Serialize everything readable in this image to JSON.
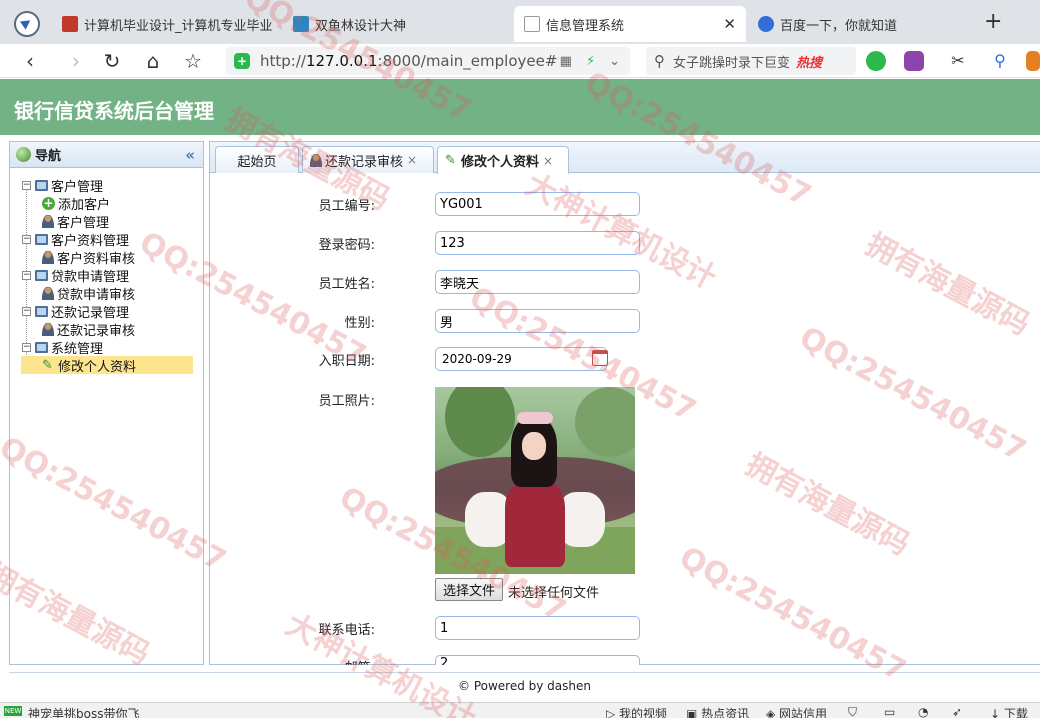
{
  "browser": {
    "tabs": [
      {
        "title": "计算机毕业设计_计算机专业毕业",
        "favicon_color": "#c0392b"
      },
      {
        "title": "双鱼林设计大神",
        "favicon_color": "#2e86c1"
      },
      {
        "title": "信息管理系统",
        "favicon_color": "#bbbbbb"
      },
      {
        "title": "百度一下，你就知道",
        "favicon_color": "#2f6fd6"
      }
    ],
    "url_prefix": "http://",
    "url_host": "127.0.0.1",
    "url_rest": ":8000/main_employee#",
    "search_text": "女子跳操时录下巨变",
    "hot_label": "热搜"
  },
  "app": {
    "title": "银行信贷系统后台管理"
  },
  "sidebar": {
    "title": "导航",
    "collapse_glyph": "«",
    "groups": [
      {
        "label": "客户管理",
        "items": [
          "添加客户",
          "客户管理"
        ]
      },
      {
        "label": "客户资料管理",
        "items": [
          "客户资料审核"
        ]
      },
      {
        "label": "贷款申请管理",
        "items": [
          "贷款申请审核"
        ]
      },
      {
        "label": "还款记录管理",
        "items": [
          "还款记录审核"
        ]
      },
      {
        "label": "系统管理",
        "items": [
          "修改个人资料"
        ]
      }
    ]
  },
  "main_tabs": [
    {
      "label": "起始页"
    },
    {
      "label": "还款记录审核",
      "close": "×"
    },
    {
      "label": "修改个人资料",
      "close": "×"
    }
  ],
  "form": {
    "employee_no_label": "员工编号:",
    "employee_no": "YG001",
    "password_label": "登录密码:",
    "password": "123",
    "name_label": "员工姓名:",
    "name": "李晓天",
    "gender_label": "性别:",
    "gender": "男",
    "hire_date_label": "入职日期:",
    "hire_date": "2020-09-29",
    "photo_label": "员工照片:",
    "file_button": "选择文件",
    "file_status": "未选择任何文件",
    "phone_label": "联系电话:",
    "phone": "1",
    "email_label": "邮箱:",
    "email": "2"
  },
  "footer": {
    "text": "© Powered by dashen"
  },
  "statusbar": {
    "new_badge": "NEW",
    "left_text": "神宠单挑boss带你飞",
    "items": [
      "我的视频",
      "热点资讯",
      "网站信用",
      "下载"
    ]
  },
  "watermarks": [
    "QQ:254540457",
    "拥有海量源码",
    "大神计算机设计",
    "QQ:254540457",
    "拥有海量源码",
    "QQ:254540457",
    "大神计算机设计",
    "QQ:254540457"
  ]
}
